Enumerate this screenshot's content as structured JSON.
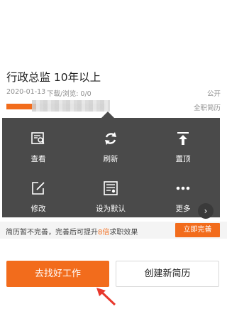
{
  "resume": {
    "title": "行政总监 10年以上",
    "date": "2020-01-13",
    "downloads_views": "下载/浏览: 0/0",
    "visibility": "公开",
    "resume_type": "全职简历",
    "completion_fraction": 0.3
  },
  "menu": {
    "items": [
      {
        "label": "查看",
        "icon": "view-resume-icon"
      },
      {
        "label": "刷新",
        "icon": "refresh-icon"
      },
      {
        "label": "置顶",
        "icon": "pin-top-icon"
      },
      {
        "label": "修改",
        "icon": "edit-icon"
      },
      {
        "label": "设为默认",
        "icon": "set-default-icon"
      },
      {
        "label": "更多",
        "icon": "more-icon"
      }
    ]
  },
  "notice": {
    "prefix": "简历暂不完善，完善后可提升",
    "highlight": "8倍",
    "suffix": "求职效果",
    "button_label": "立即完善"
  },
  "actions": {
    "find_job_label": "去找好工作",
    "create_resume_label": "创建新简历"
  },
  "colors": {
    "accent": "#f26c1c",
    "menu_bg": "#4a4a4a",
    "annotation": "#e8382c"
  }
}
